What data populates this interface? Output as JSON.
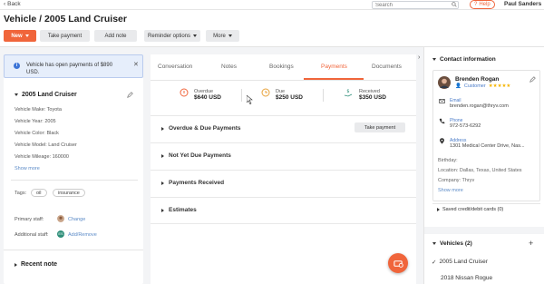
{
  "topbar": {
    "back_label": "Back",
    "search_placeholder": "Search",
    "help_label": "Help",
    "user_name": "Paul Sanders"
  },
  "header": {
    "title": "Vehicle / 2005 Land Cruiser",
    "actions": {
      "new": "New",
      "take_payment": "Take payment",
      "add_note": "Add note",
      "reminder_options": "Reminder options",
      "more": "More"
    }
  },
  "alert": {
    "text": "Vehicle has open payments of $890 USD."
  },
  "vehicle": {
    "heading": "2005 Land Cruiser",
    "fields": [
      "Vehicle Make: Toyota",
      "Vehicle Year: 2005",
      "Vehicle Color: Black",
      "Vehicle Model: Land Cruiser",
      "Vehicle Mileage: 160000"
    ],
    "show_more": "Show more",
    "tags_label": "Tags:",
    "tags": [
      "oil",
      "insurance"
    ],
    "primary_staff_label": "Primary staff:",
    "primary_staff_action": "Change",
    "additional_staff_label": "Additional staff:",
    "additional_staff_initials": "ES",
    "additional_staff_action": "Add/Remove",
    "recent_note": "Recent note"
  },
  "tabs": [
    "Conversation",
    "Notes",
    "Bookings",
    "Payments",
    "Documents"
  ],
  "active_tab": "Payments",
  "payments": {
    "overdue_label": "Overdue",
    "overdue_value": "$640 USD",
    "due_label": "Due",
    "due_value": "$250 USD",
    "received_label": "Received",
    "received_value": "$350 USD",
    "sections": [
      "Overdue & Due Payments",
      "Not Yet Due Payments",
      "Payments Received",
      "Estimates"
    ],
    "take_payment": "Take payment"
  },
  "contact": {
    "heading": "Contact information",
    "name": "Brenden Rogan",
    "role": "Customer",
    "rating": "★★★★★",
    "email_label": "Email",
    "email": "brenden.rogan@thryv.com",
    "phone_label": "Phone",
    "phone": "972-573-6292",
    "address_label": "Address",
    "address": "1301 Medical Center Drive, Nas...",
    "birthday": "Birthday:",
    "location": "Location: Dallas, Texas, United States",
    "company": "Company: Thryv",
    "show_more": "Show more",
    "saved_cards": "Saved credit/debit cards (0)"
  },
  "vehicles": {
    "heading": "Vehicles (2)",
    "items": [
      "2005 Land Cruiser",
      "2018 Nissan Rogue"
    ]
  },
  "colors": {
    "accent": "#f0653b",
    "link": "#4a7bc8",
    "alert_bg": "#e6eefb",
    "stars": "#f5b400"
  }
}
